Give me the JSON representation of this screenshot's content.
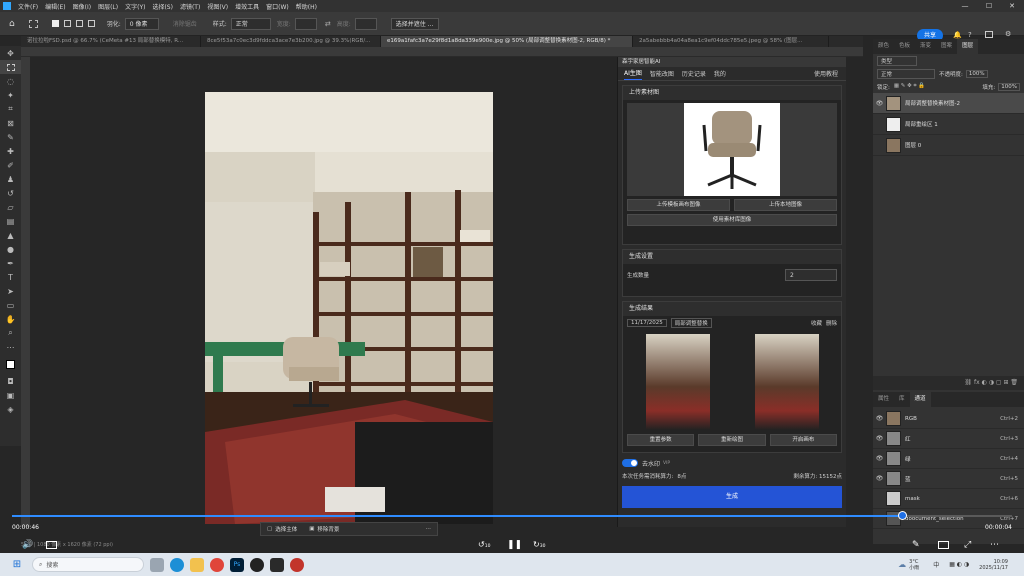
{
  "menu": {
    "items": [
      "文件(F)",
      "编辑(E)",
      "图像(I)",
      "图层(L)",
      "文字(Y)",
      "选择(S)",
      "滤镜(T)",
      "视图(V)",
      "增效工具",
      "窗口(W)",
      "帮助(H)"
    ]
  },
  "options": {
    "feather_label": "羽化:",
    "feather_value": "0 像素",
    "antialias": "消除锯齿",
    "style_label": "样式:",
    "style_value": "正常",
    "width_label": "宽度:",
    "height_label": "高度:",
    "select_mask": "选择并遮住 ...",
    "share": "共享"
  },
  "doc_tabs": [
    "诺拉拉啦FSD.psd @ 66.7% (CeMeta #13 局部替换模特, R...",
    "8ce5f53a7c0ec3d9fddca3ace7e3b200.jpg @ 39.3%(RGB/...",
    "e169a1fafc3a7e29f8d1a8da339e900e.jpg @ 50% (局部调整替换素材图-2, RGB/8) *",
    "2a5abebbb4a04a8ea1c9ef04ddc785e5.jpeg @ 58% (图层..."
  ],
  "plugin": {
    "header": "森宇家居智能AI",
    "tabs": [
      "AI生图",
      "智能改图",
      "历史记录",
      "我的"
    ],
    "help": "使用教程",
    "upload_section": "上传素材图",
    "upload_canvas_btn": "上传模板画布图像",
    "upload_local_btn": "上传本地图像",
    "use_library_btn": "使用素材库图像",
    "settings_section": "生成设置",
    "count_label": "生成数量",
    "count_value": "2",
    "results_section": "生成结果",
    "result_date": "11/17/2025",
    "result_tag": "局部调整替换",
    "favorite": "收藏",
    "delete": "删除",
    "regen_params": "重置参数",
    "redraw": "重新绘图",
    "open_canvas": "开启画布",
    "watermark": "去水印",
    "watermark_badge": "VIP",
    "cost_label": "本次任务需消耗算力:",
    "cost_value": "8点",
    "remain_label": "剩余算力: 15152点",
    "generate": "生成"
  },
  "photo_toolbar": {
    "select_subject": "选择主体",
    "remove_bg": "移除背景"
  },
  "layers_panel": {
    "tabs": [
      "颜色",
      "色板",
      "渐变",
      "图案",
      "图层"
    ],
    "kind": "类型",
    "blend": "正常",
    "opacity_label": "不透明度:",
    "opacity": "100%",
    "lock_label": "锁定:",
    "fill_label": "填充:",
    "fill": "100%",
    "layers": [
      {
        "name": "局部调整替换素材图-2",
        "selected": true
      },
      {
        "name": "局部重绘区 1",
        "selected": false
      },
      {
        "name": "图层 0",
        "selected": false
      }
    ]
  },
  "channels_panel": {
    "tabs": [
      "属性",
      "库",
      "通道"
    ],
    "channels": [
      {
        "name": "RGB",
        "shortcut": "Ctrl+2"
      },
      {
        "name": "红",
        "shortcut": "Ctrl+3"
      },
      {
        "name": "绿",
        "shortcut": "Ctrl+4"
      },
      {
        "name": "蓝",
        "shortcut": "Ctrl+5"
      },
      {
        "name": "mask",
        "shortcut": "Ctrl+6"
      },
      {
        "name": "doocument_selection",
        "shortcut": "Ctrl+7"
      }
    ]
  },
  "status": {
    "zoom_info": "50% | 1080 像素 x 1620 像素 (72 ppi)"
  },
  "video": {
    "elapsed": "00:00:46",
    "remaining": "00:00:04",
    "rewind": "10",
    "forward": "30",
    "progress": 0.89
  },
  "taskbar": {
    "search": "搜索",
    "weather_temp": "3°C",
    "weather_desc": "小雨",
    "lang": "中",
    "time": "10:09",
    "date": "2025/11/17"
  }
}
